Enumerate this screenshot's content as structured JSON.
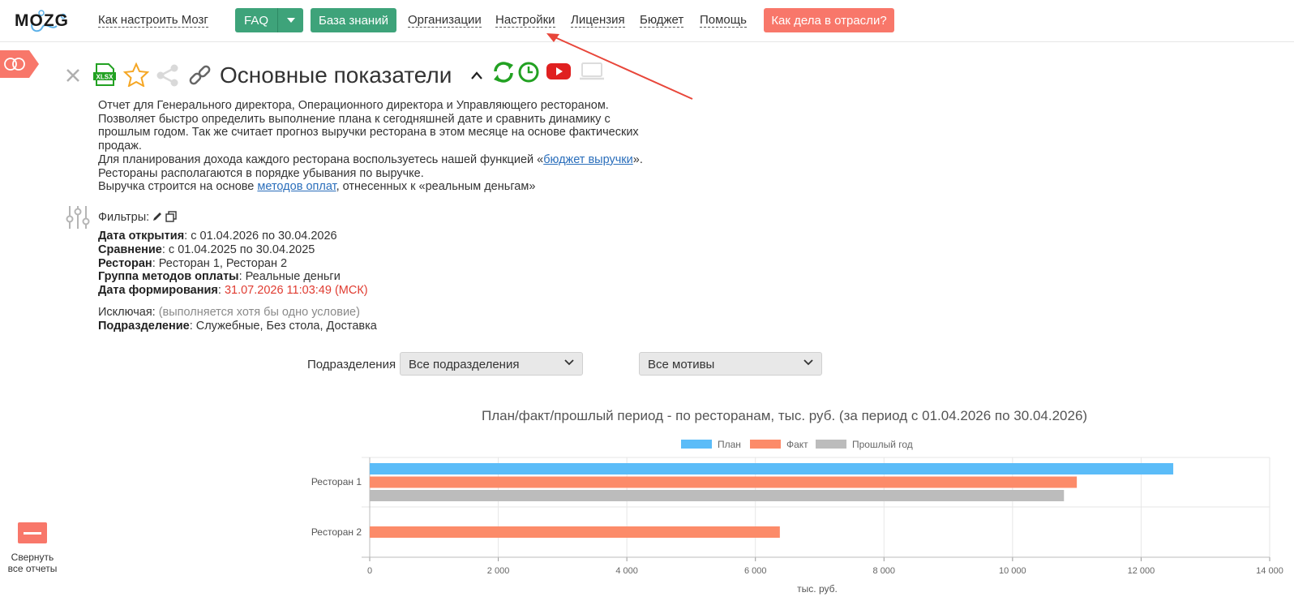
{
  "nav": {
    "logo": "MOZG",
    "how_to": "Как настроить Мозг",
    "faq": "FAQ",
    "knowledge": "База знаний",
    "orgs": "Организации",
    "settings": "Настройки",
    "license": "Лицензия",
    "budget": "Бюджет",
    "help": "Помощь",
    "industry": "Как дела в отрасли?"
  },
  "report": {
    "title": "Основные показатели",
    "desc_1": "Отчет для Генерального директора, Операционного директора и Управляющего рестораном.",
    "desc_2": "Позволяет быстро определить выполнение плана к сегодняшней дате и сравнить динамику с",
    "desc_3": "прошлым годом. Так же считает прогноз выручки ресторана в этом месяце на основе фактических",
    "desc_4": "продаж.",
    "desc_5_pre": "Для планирования дохода каждого ресторана воспользуетесь нашей функцией «",
    "desc_5_link": "бюджет выручки",
    "desc_5_post": "».",
    "desc_6": "Рестораны располагаются в порядке убывания по выручке.",
    "desc_7_pre": "Выручка строится на основе ",
    "desc_7_link": "методов оплат",
    "desc_7_post": ", отнесенных к «реальным деньгам»"
  },
  "filters": {
    "label": "Фильтры:",
    "open_date_label": "Дата открытия",
    "open_date_value": ": с 01.04.2026 по 30.04.2026",
    "compare_label": "Сравнение",
    "compare_value": ": с 01.04.2025 по 30.04.2025",
    "restaurant_label": "Ресторан",
    "restaurant_value": ": Ресторан 1, Ресторан 2",
    "payment_label": "Группа методов оплаты",
    "payment_value": ": Реальные деньги",
    "generated_label": "Дата формирования",
    "generated_colon": ": ",
    "generated_value": "31.07.2026 11:03:49 (МСК)",
    "exclude_label": "Исключая:",
    "exclude_note": " (выполняется хотя бы одно условие)",
    "division_label": "Подразделение",
    "division_value": ": Служебные, Без стола, Доставка"
  },
  "controls": {
    "divisions_label": "Подразделения",
    "divisions_value": "Все подразделения",
    "motives_value": "Все мотивы"
  },
  "sidebar": {
    "collapse_label": "Свернуть все отчеты"
  },
  "colors": {
    "plan": "#5bbcf8",
    "fact": "#fc8b69",
    "prev": "#bcbcbc",
    "green": "#3ea37a",
    "salmon": "#f8776a"
  },
  "chart_data": {
    "type": "bar",
    "orientation": "horizontal",
    "title": "План/факт/прошлый период - по ресторанам, тыс. руб. (за период с 01.04.2026 по 30.04.2026)",
    "categories": [
      "Ресторан 1",
      "Ресторан 2"
    ],
    "series": [
      {
        "name": "План",
        "values": [
          12500,
          0
        ]
      },
      {
        "name": "Факт",
        "values": [
          11000,
          6380
        ]
      },
      {
        "name": "Прошлый год",
        "values": [
          10800,
          0
        ]
      }
    ],
    "xlabel": "тыс. руб.",
    "xlim": [
      0,
      14000
    ],
    "xticks": [
      "0",
      "2 000",
      "4 000",
      "6 000",
      "8 000",
      "10 000",
      "12 000",
      "14 000"
    ],
    "legend": "top",
    "grid": true
  }
}
